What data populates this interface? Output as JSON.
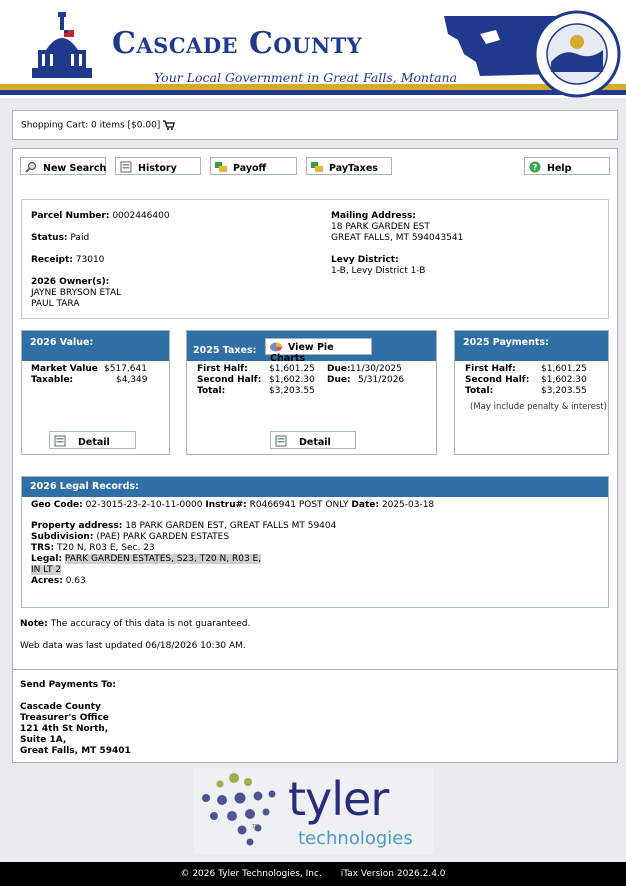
{
  "header": {
    "title": "Cascade County",
    "tagline": "Your Local Government in Great Falls, Montana",
    "seal_text": "County of Cascade · State of Montana",
    "colors": {
      "brand_blue": "#1f3a8c",
      "gold": "#d6a92e",
      "panel_blue": "#2f6fa6"
    }
  },
  "cart": {
    "text": "Shopping Cart: 0 items [$0.00]",
    "icon": "cart-icon"
  },
  "toolbar": {
    "new_search": "New Search",
    "history": "History",
    "payoff": "Payoff",
    "paytaxes": "PayTaxes",
    "help": "Help"
  },
  "parcel": {
    "parcel_label": "Parcel Number:",
    "parcel_value": "0002446400",
    "status_label": "Status:",
    "status_value": "Paid",
    "receipt_label": "Receipt:",
    "receipt_value": "73010",
    "owners_label": "2026 Owner(s):",
    "owner1": "JAYNE BRYSON ETAL",
    "owner2": "PAUL TARA",
    "mailing_label": "Mailing Address:",
    "mailing1": "18 PARK GARDEN EST",
    "mailing2": "GREAT FALLS, MT 594043541",
    "levy_label": "Levy District:",
    "levy_value": "1-B, Levy District 1-B"
  },
  "value_card": {
    "header": "2026 Value:",
    "market_label": "Market Value",
    "market_value": "$517,641",
    "taxable_label": "Taxable:",
    "taxable_value": "$4,349",
    "detail": "Detail"
  },
  "taxes_card": {
    "header": "2025 Taxes:",
    "pie_button": "View Pie Charts",
    "first_label": "First Half:",
    "first_value": "$1,601.25",
    "second_label": "Second Half:",
    "second_value": "$1,602.30",
    "total_label": "Total:",
    "total_value": "$3,203.55",
    "due_label": "Due:",
    "due1": "11/30/2025",
    "due2": "5/31/2026",
    "detail": "Detail"
  },
  "payments_card": {
    "header": "2025 Payments:",
    "first_label": "First Half:",
    "first_value": "$1,601.25",
    "second_label": "Second Half:",
    "second_value": "$1,602.30",
    "total_label": "Total:",
    "total_value": "$3,203.55",
    "note": "(May include penalty & interest)"
  },
  "legal": {
    "header": "2026 Legal Records:",
    "geo_label": "Geo Code:",
    "geo_value": "02-3015-23-2-10-11-0000",
    "instru_label": "Instru#:",
    "instru_value": "R0466941 POST ONLY",
    "date_label": "Date:",
    "date_value": "2025-03-18",
    "property_label": "Property address:",
    "property_value": "18 PARK GARDEN EST, GREAT FALLS MT 59404",
    "subdivision_label": "Subdivision:",
    "subdivision_value": "(PAE) PARK GARDEN ESTATES",
    "trs_label": "TRS:",
    "trs_value": "T20 N, R03 E, Sec. 23",
    "legal_label": "Legal:",
    "legal_value1": "PARK GARDEN ESTATES, S23, T20 N, R03 E,",
    "legal_value2": "IN LT 2",
    "acres_label": "Acres:",
    "acres_value": "0.63"
  },
  "notes": {
    "note_label": "Note:",
    "note_text": "The accuracy of this data is not guaranteed.",
    "updated": "Web data was last updated 06/18/2026 10:30 AM."
  },
  "send": {
    "heading": "Send Payments To:",
    "line1": "Cascade County",
    "line2": "Treasurer's Office",
    "line3": "121 4th St North,",
    "line4": "Suite 1A,",
    "line5": "Great Falls, MT 59401"
  },
  "logo": {
    "word": "tyler",
    "sub": "technologies",
    "tm": "TM"
  },
  "footer": {
    "copyright": "© 2026 Tyler Technologies, Inc.",
    "version": "iTax Version 2026.2.4.0"
  }
}
